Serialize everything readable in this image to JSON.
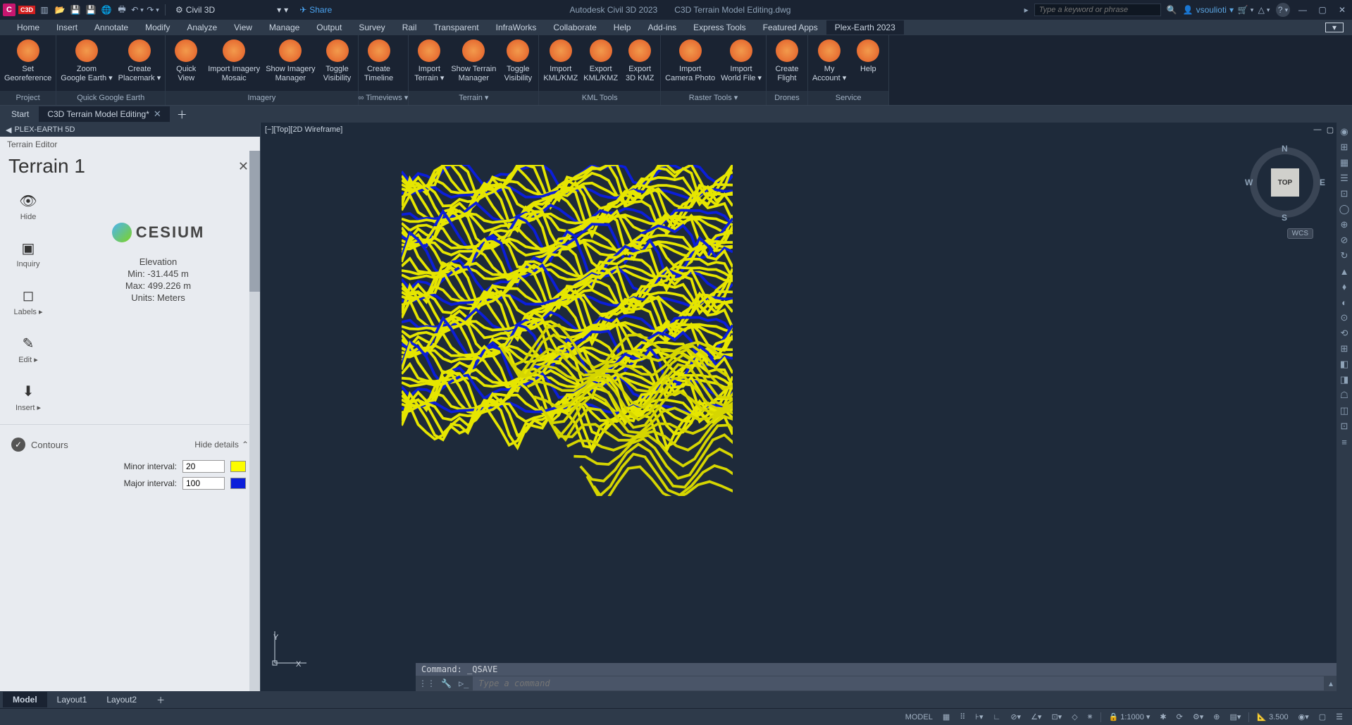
{
  "titleBar": {
    "workspace": "Civil 3D",
    "share": "Share",
    "appName": "Autodesk Civil 3D 2023",
    "fileName": "C3D Terrain Model Editing.dwg",
    "searchPlaceholder": "Type a keyword or phrase",
    "user": "vsoulioti"
  },
  "menu": {
    "items": [
      "Home",
      "Insert",
      "Annotate",
      "Modify",
      "Analyze",
      "View",
      "Manage",
      "Output",
      "Survey",
      "Rail",
      "Transparent",
      "InfraWorks",
      "Collaborate",
      "Help",
      "Add-ins",
      "Express Tools",
      "Featured Apps",
      "Plex-Earth 2023"
    ],
    "activeIndex": 17
  },
  "ribbon": {
    "panels": [
      {
        "label": "Project",
        "buttons": [
          {
            "label1": "Set",
            "label2": "Georeference"
          }
        ]
      },
      {
        "label": "Quick Google Earth",
        "buttons": [
          {
            "label1": "Zoom",
            "label2": "Google Earth",
            "dd": true
          },
          {
            "label1": "Create",
            "label2": "Placemark",
            "dd": true
          }
        ]
      },
      {
        "label": "Imagery",
        "buttons": [
          {
            "label1": "Quick",
            "label2": "View"
          },
          {
            "label1": "Import Imagery",
            "label2": "Mosaic"
          },
          {
            "label1": "Show Imagery",
            "label2": "Manager"
          },
          {
            "label1": "Toggle",
            "label2": "Visibility"
          }
        ]
      },
      {
        "label": "∞ Timeviews",
        "dd": true,
        "buttons": [
          {
            "label1": "Create",
            "label2": "Timeline"
          }
        ]
      },
      {
        "label": "Terrain",
        "dd": true,
        "buttons": [
          {
            "label1": "Import",
            "label2": "Terrain",
            "dd": true
          },
          {
            "label1": "Show Terrain",
            "label2": "Manager"
          },
          {
            "label1": "Toggle",
            "label2": "Visibility"
          }
        ]
      },
      {
        "label": "KML Tools",
        "buttons": [
          {
            "label1": "Import",
            "label2": "KML/KMZ"
          },
          {
            "label1": "Export",
            "label2": "KML/KMZ"
          },
          {
            "label1": "Export",
            "label2": "3D KMZ"
          }
        ]
      },
      {
        "label": "Raster Tools",
        "dd": true,
        "buttons": [
          {
            "label1": "Import",
            "label2": "Camera Photo"
          },
          {
            "label1": "Import",
            "label2": "World File",
            "dd": true
          }
        ]
      },
      {
        "label": "Drones",
        "buttons": [
          {
            "label1": "Create",
            "label2": "Flight"
          }
        ]
      },
      {
        "label": "Service",
        "buttons": [
          {
            "label1": "My",
            "label2": "Account",
            "dd": true
          },
          {
            "label1": "Help",
            "label2": ""
          }
        ]
      }
    ]
  },
  "fileTabs": {
    "tabs": [
      {
        "label": "Start",
        "closable": false
      },
      {
        "label": "C3D Terrain Model Editing*",
        "closable": true,
        "active": true
      }
    ]
  },
  "leftPanel": {
    "titleBar": "PLEX-EARTH 5D",
    "editorLabel": "Terrain Editor",
    "terrainName": "Terrain 1",
    "tools": [
      {
        "icon": "eye",
        "label": "Hide"
      },
      {
        "icon": "inquiry",
        "label": "Inquiry"
      },
      {
        "icon": "tag",
        "label": "Labels",
        "dd": true
      },
      {
        "icon": "pencil",
        "label": "Edit",
        "dd": true
      },
      {
        "icon": "download",
        "label": "Insert",
        "dd": true
      }
    ],
    "provider": "CESIUM",
    "elevation": {
      "title": "Elevation",
      "min": "Min: -31.445 m",
      "max": "Max: 499.226 m",
      "units": "Units: Meters"
    },
    "contours": {
      "title": "Contours",
      "hideDetails": "Hide details",
      "minorLabel": "Minor interval:",
      "minorValue": "20",
      "minorColor": "#fcfc00",
      "majorLabel": "Major interval:",
      "majorValue": "100",
      "majorColor": "#0b1eda"
    }
  },
  "viewport": {
    "label": "[−][Top][2D Wireframe]",
    "cube": {
      "top": "TOP",
      "n": "N",
      "s": "S",
      "e": "E",
      "w": "W"
    },
    "wcs": "WCS",
    "ucs": {
      "x": "X",
      "y": "Y"
    }
  },
  "commandLine": {
    "history": "Command: _QSAVE",
    "placeholder": "Type a command"
  },
  "layoutTabs": {
    "tabs": [
      "Model",
      "Layout1",
      "Layout2"
    ],
    "activeIndex": 0
  },
  "statusBar": {
    "model": "MODEL",
    "scale": "1:1000",
    "decimal": "3.500"
  }
}
